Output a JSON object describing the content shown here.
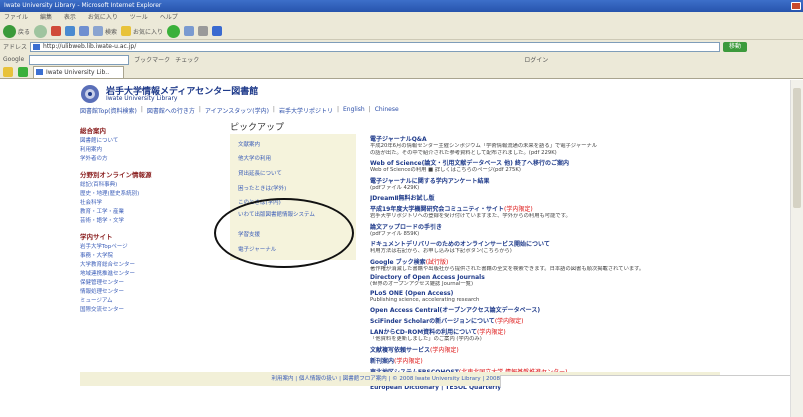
{
  "window": {
    "title": "Iwate University Library - Microsoft Internet Explorer"
  },
  "menu": [
    "ファイル",
    "編集",
    "表示",
    "お気に入り",
    "ツール",
    "ヘルプ"
  ],
  "toolbar": {
    "back_label": "戻る",
    "search_label": "検索",
    "favorites_label": "お気に入り"
  },
  "address": {
    "label": "アドレス",
    "url": "http://ulibweb.lib.iwate-u.ac.jp/",
    "go_label": "移動"
  },
  "google": {
    "label": "Google",
    "bookmarks_label": "ブックマーク",
    "check_label": "チェック",
    "login_label": "ログイン"
  },
  "tab": {
    "title": "Iwate University Lib.."
  },
  "site": {
    "title": "岩手大学情報メディアセンター図書館",
    "subtitle": "Iwate University Library"
  },
  "topnav": [
    "図書館Top(資料検索)",
    "図書館への行き方",
    "アイアンスタッツ(学内)",
    "岩手大学リポジトリ",
    "English",
    "Chinese"
  ],
  "sidebar": {
    "sections": [
      {
        "heading": "総合案内",
        "items": [
          "図書館について",
          "利用案内",
          "学外者の方"
        ]
      },
      {
        "heading": "分野別オンライン情報源",
        "items": [
          "総記(百科事典)",
          "歴史・地理(歴史系統別)",
          "社会科学",
          "教育・工学・産業",
          "芸術・語学・文学"
        ]
      },
      {
        "heading": "学内サイト",
        "items": [
          "岩手大学Topページ",
          "事務・大学院",
          "大学教育総合センター",
          "地域連携推進センター",
          "保健管理センター",
          "情報処理センター",
          "ミュージアム",
          "国際交流センター"
        ]
      }
    ]
  },
  "pickup": {
    "title": "ピックアップ",
    "items": [
      "文献案内",
      "他大学の利用",
      "貸出延長について",
      "困ったときは(学外)",
      "このときは(学内)",
      "いわて出版図書館情報システム",
      "学習支援",
      "電子ジャーナル"
    ]
  },
  "news": [
    {
      "title": "電子ジャーナルQ&A",
      "new": "",
      "desc": [
        "平成20年6月の情報センター主催シンポジウム「学術情報流通の未来を語る」で電子ジャーナル",
        "の話が出た。その中で紹介された参考資料として配布されました。(pdf 229K)"
      ]
    },
    {
      "title": "Web of Science(論文・引用文献データベース 他) 終了へ移行のご案内",
      "new": "",
      "desc": [
        "Web of Scienceの利用 ■ 詳しくはこちらのページ(pdf 275K)"
      ]
    },
    {
      "title": "電子ジャーナルに関する学内アンケート結果",
      "new": "",
      "desc": [
        "(pdfファイル 429K)"
      ]
    },
    {
      "title": "JDreamⅡ無料お試し版",
      "new": "",
      "desc": []
    },
    {
      "title": "平成19年度大学機関研究会コミュニティ・サイト",
      "new": "(学内限定)",
      "desc": [
        "岩手大学リポジトリへの登録を受け付けていますまた、学外からの利用も可能です。"
      ]
    },
    {
      "title": "論文アップロードの手引き",
      "new": "",
      "desc": [
        "(pdfファイル 859K)"
      ]
    },
    {
      "title": "ドキュメントデリバリーのためのオンラインサービス開始について",
      "new": "",
      "desc": [
        "利用方法は右記から、お申し込みは下記ボタン(こちらから)"
      ]
    },
    {
      "title": "Google ブック検索",
      "new": "(試行版)",
      "desc": [
        "著作権が消滅した書籍や出版社から提供された書籍の全文を検索できます。日本語の図書も順次掲載されています。"
      ]
    },
    {
      "title": "Directory of Open Access Journals",
      "new": "",
      "desc": [
        "(世界のオープンアクセス雑誌 Journal一覧)"
      ]
    },
    {
      "title": "PLoS ONE (Open Access)",
      "new": "",
      "desc": [
        "Publishing science, accelerating research"
      ]
    },
    {
      "title": "Open Access Central(オープンアクセス論文データベース)",
      "new": "",
      "desc": []
    },
    {
      "title": "SciFinder Scholarの新バージョンについて",
      "new": "(学内限定)",
      "desc": []
    },
    {
      "title": "LANからCD-ROM資料の利用について",
      "new": "(学内限定)",
      "desc": [
        "「他資料を更新しました」のご案内 (学内のみ)"
      ]
    },
    {
      "title": "文献複写依頼サービス",
      "new": "(学内限定)",
      "desc": []
    },
    {
      "title": "新刊案内",
      "new": "(学内限定)",
      "desc": []
    },
    {
      "title": "東北地区システムEBSCOHOST",
      "new": "(北東北国立大学 情報基盤推進センター)",
      "desc": [
        "新着通知電子ジャーナル"
      ]
    },
    {
      "title": "European Dictionary | TESOL Quarterly",
      "new": "",
      "desc": []
    }
  ],
  "footer": {
    "text": "利用案内 | 個人情報の扱い | 図書館フロア案内 | © 2008 Iwate University Library | 2008.10.14更新"
  },
  "colors": {
    "accent": "#1e3a8a",
    "heading": "#8a1f1f",
    "link": "#3a5db8",
    "pickup_bg": "#f5f3dc"
  }
}
